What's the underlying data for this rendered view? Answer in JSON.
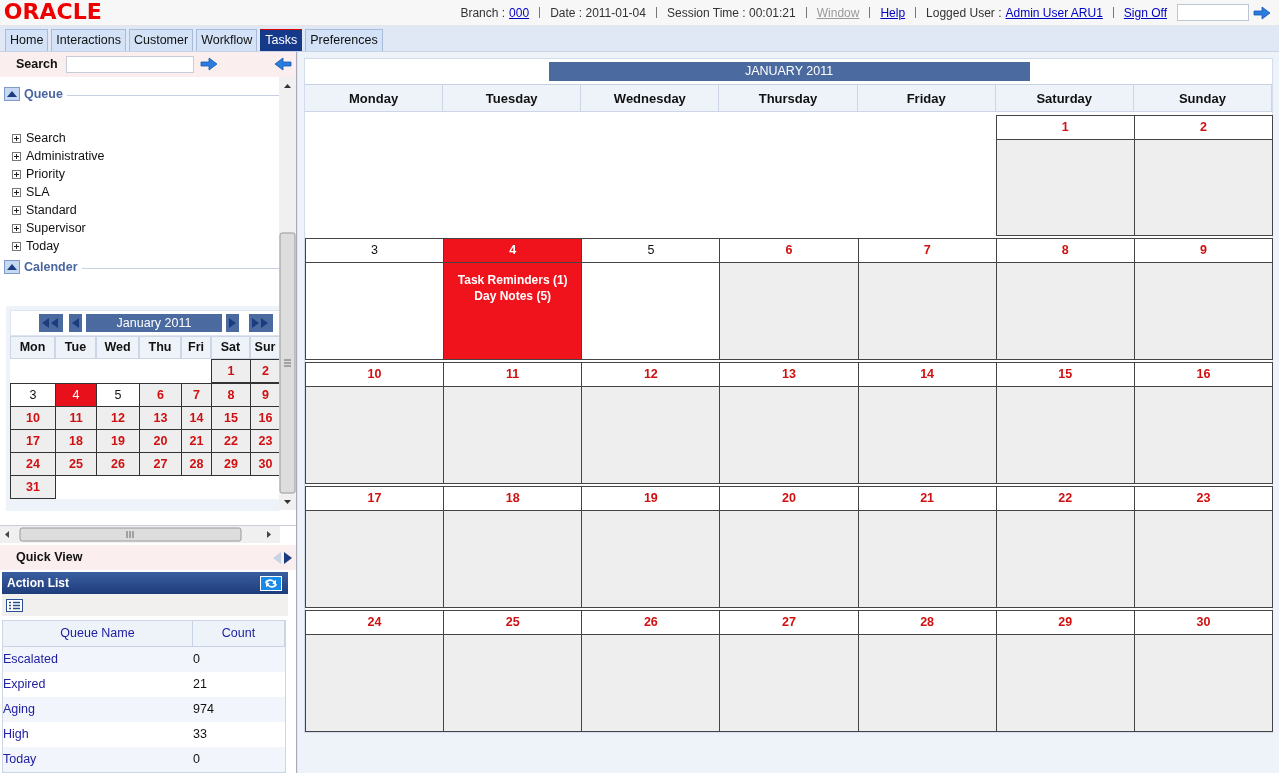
{
  "header": {
    "logo": "ORACLE",
    "items": [
      {
        "label": "Branch :",
        "link": "000",
        "disabled": false
      },
      {
        "label": "Date : 2011-01-04"
      },
      {
        "label": "Session Time : 00:01:21"
      },
      {
        "link": "Window",
        "disabled": true
      },
      {
        "link": "Help",
        "disabled": false
      },
      {
        "label": "Logged User :",
        "link": "Admin User ARU1",
        "disabled": false
      },
      {
        "link": "Sign Off",
        "disabled": false
      }
    ]
  },
  "tabs": [
    {
      "label": "Home",
      "selected": false
    },
    {
      "label": "Interactions",
      "selected": false
    },
    {
      "label": "Customer",
      "selected": false
    },
    {
      "label": "Workflow",
      "selected": false
    },
    {
      "label": "Tasks",
      "selected": true
    },
    {
      "label": "Preferences",
      "selected": false
    }
  ],
  "sidebar": {
    "search": {
      "label": "Search"
    },
    "sections": [
      {
        "title": "Queue",
        "expanded": true,
        "items": [
          {
            "label": "Search",
            "expanded": false
          },
          {
            "label": "Administrative",
            "expanded": false
          },
          {
            "label": "Priority",
            "expanded": false
          },
          {
            "label": "SLA",
            "expanded": false
          },
          {
            "label": "Standard",
            "expanded": false
          },
          {
            "label": "Supervisor",
            "expanded": false
          },
          {
            "label": "Today",
            "expanded": false
          }
        ]
      },
      {
        "title": "Calender",
        "expanded": true
      }
    ],
    "mini_calendar": {
      "title": "January 2011",
      "weekdays": [
        "Mon",
        "Tue",
        "Wed",
        "Thu",
        "Fri",
        "Sat",
        "Sur"
      ],
      "weeks": [
        [
          {
            "kind": "blank"
          },
          {
            "kind": "blank"
          },
          {
            "kind": "blank"
          },
          {
            "kind": "blank"
          },
          {
            "kind": "blank"
          },
          {
            "day": "1",
            "kind": "normal"
          },
          {
            "day": "2",
            "kind": "normal"
          }
        ],
        [
          {
            "day": "3",
            "kind": "current"
          },
          {
            "day": "4",
            "kind": "today"
          },
          {
            "day": "5",
            "kind": "current"
          },
          {
            "day": "6",
            "kind": "normal"
          },
          {
            "day": "7",
            "kind": "normal"
          },
          {
            "day": "8",
            "kind": "normal"
          },
          {
            "day": "9",
            "kind": "normal"
          }
        ],
        [
          {
            "day": "10",
            "kind": "normal"
          },
          {
            "day": "11",
            "kind": "normal"
          },
          {
            "day": "12",
            "kind": "normal"
          },
          {
            "day": "13",
            "kind": "normal"
          },
          {
            "day": "14",
            "kind": "normal"
          },
          {
            "day": "15",
            "kind": "normal"
          },
          {
            "day": "16",
            "kind": "normal"
          }
        ],
        [
          {
            "day": "17",
            "kind": "normal"
          },
          {
            "day": "18",
            "kind": "normal"
          },
          {
            "day": "19",
            "kind": "normal"
          },
          {
            "day": "20",
            "kind": "normal"
          },
          {
            "day": "21",
            "kind": "normal"
          },
          {
            "day": "22",
            "kind": "normal"
          },
          {
            "day": "23",
            "kind": "normal"
          }
        ],
        [
          {
            "day": "24",
            "kind": "normal"
          },
          {
            "day": "25",
            "kind": "normal"
          },
          {
            "day": "26",
            "kind": "normal"
          },
          {
            "day": "27",
            "kind": "normal"
          },
          {
            "day": "28",
            "kind": "normal"
          },
          {
            "day": "29",
            "kind": "normal"
          },
          {
            "day": "30",
            "kind": "normal"
          }
        ],
        [
          {
            "day": "31",
            "kind": "normal"
          },
          {
            "kind": "blank"
          },
          {
            "kind": "blank"
          },
          {
            "kind": "blank"
          },
          {
            "kind": "blank"
          },
          {
            "kind": "blank"
          },
          {
            "kind": "blank"
          }
        ]
      ]
    },
    "quick_view": {
      "title": "Quick View"
    },
    "action_list": {
      "title": "Action List",
      "columns": [
        "Queue Name",
        "Count"
      ],
      "rows": [
        {
          "name": "Escalated",
          "count": "0"
        },
        {
          "name": "Expired",
          "count": "21"
        },
        {
          "name": "Aging",
          "count": "974"
        },
        {
          "name": "High",
          "count": "33"
        },
        {
          "name": "Today",
          "count": "0"
        }
      ]
    }
  },
  "calendar": {
    "title": "JANUARY 2011",
    "weekdays": [
      "Monday",
      "Tuesday",
      "Wednesday",
      "Thursday",
      "Friday",
      "Saturday",
      "Sunday"
    ],
    "weeks": [
      [
        {
          "kind": "blank"
        },
        {
          "kind": "blank"
        },
        {
          "kind": "blank"
        },
        {
          "kind": "blank"
        },
        {
          "kind": "blank"
        },
        {
          "day": "1",
          "kind": "normal"
        },
        {
          "day": "2",
          "kind": "normal"
        }
      ],
      [
        {
          "day": "3",
          "kind": "current"
        },
        {
          "day": "4",
          "kind": "today",
          "notes": [
            "Task Reminders (1)",
            "Day Notes (5)"
          ]
        },
        {
          "day": "5",
          "kind": "current"
        },
        {
          "day": "6",
          "kind": "normal"
        },
        {
          "day": "7",
          "kind": "normal"
        },
        {
          "day": "8",
          "kind": "normal"
        },
        {
          "day": "9",
          "kind": "normal"
        }
      ],
      [
        {
          "day": "10",
          "kind": "normal"
        },
        {
          "day": "11",
          "kind": "normal"
        },
        {
          "day": "12",
          "kind": "normal"
        },
        {
          "day": "13",
          "kind": "normal"
        },
        {
          "day": "14",
          "kind": "normal"
        },
        {
          "day": "15",
          "kind": "normal"
        },
        {
          "day": "16",
          "kind": "normal"
        }
      ],
      [
        {
          "day": "17",
          "kind": "normal"
        },
        {
          "day": "18",
          "kind": "normal"
        },
        {
          "day": "19",
          "kind": "normal"
        },
        {
          "day": "20",
          "kind": "normal"
        },
        {
          "day": "21",
          "kind": "normal"
        },
        {
          "day": "22",
          "kind": "normal"
        },
        {
          "day": "23",
          "kind": "normal"
        }
      ],
      [
        {
          "day": "24",
          "kind": "normal"
        },
        {
          "day": "25",
          "kind": "normal"
        },
        {
          "day": "26",
          "kind": "normal"
        },
        {
          "day": "27",
          "kind": "normal"
        },
        {
          "day": "28",
          "kind": "normal"
        },
        {
          "day": "29",
          "kind": "normal"
        },
        {
          "day": "30",
          "kind": "normal"
        }
      ]
    ]
  }
}
